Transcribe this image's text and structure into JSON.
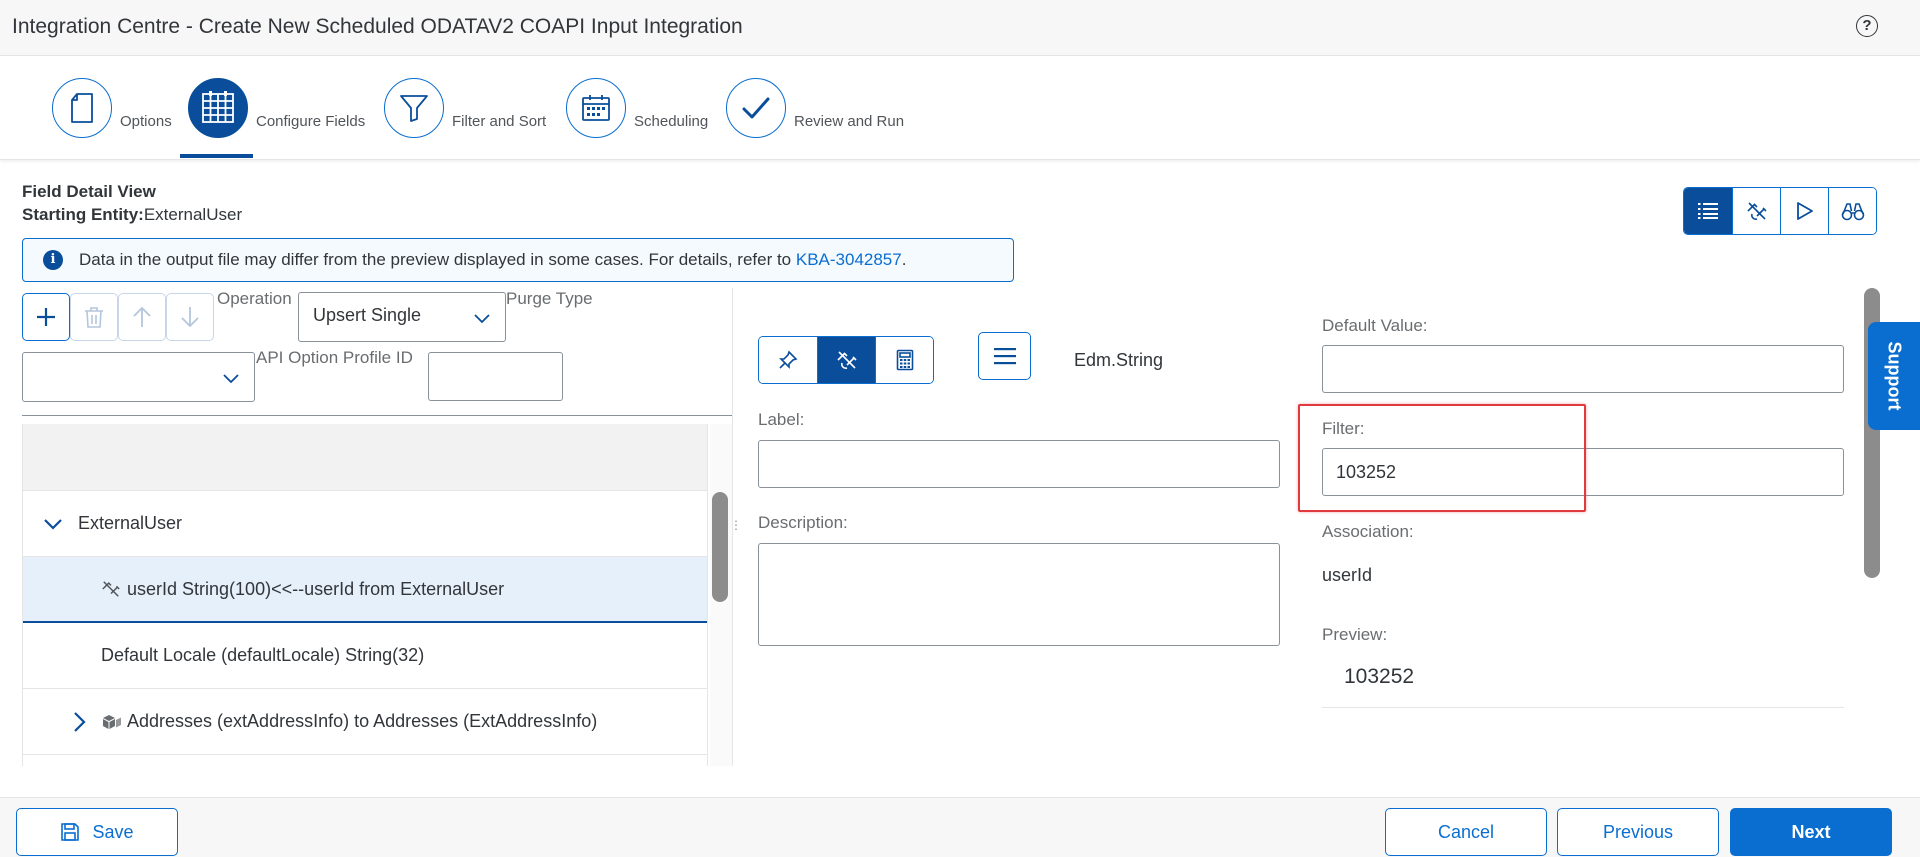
{
  "header": {
    "title": "Integration Centre - Create New Scheduled ODATAV2 COAPI Input Integration",
    "help_symbol": "?"
  },
  "wizard": {
    "steps": [
      {
        "label": "Options",
        "icon": "document-icon"
      },
      {
        "label": "Configure Fields",
        "icon": "table-icon"
      },
      {
        "label": "Filter and Sort",
        "icon": "filter-icon"
      },
      {
        "label": "Scheduling",
        "icon": "calendar-icon"
      },
      {
        "label": "Review and Run",
        "icon": "checkmark-icon"
      }
    ],
    "active_step": "Configure Fields"
  },
  "field_detail": {
    "title": "Field Detail View",
    "starting_entity_label": "Starting Entity:",
    "starting_entity_value": "ExternalUser"
  },
  "info": {
    "text": "Data in the output file may differ from the preview displayed in some cases. For details, refer to ",
    "link": "KBA-3042857",
    "suffix": "."
  },
  "left_panel": {
    "operation_label": "Operation",
    "operation_value": "Upsert Single",
    "purge_type_label": "Purge Type",
    "purge_type_value": "",
    "api_option_profile_label": "API Option Profile ID",
    "api_option_profile_value": ""
  },
  "tree": {
    "rows": [
      {
        "text": "ExternalUser",
        "icon": "chevron-down-icon"
      },
      {
        "text": "userId String(100)<<--userId from ExternalUser",
        "icon": "unlink-icon"
      },
      {
        "text": "Default Locale (defaultLocale) String(32)",
        "icon": ""
      },
      {
        "text": "Addresses (extAddressInfo) to Addresses (ExtAddressInfo)",
        "icon": "chevron-right-icon"
      }
    ]
  },
  "middle_panel": {
    "type": "Edm.String",
    "label_label": "Label:",
    "label_value": "",
    "description_label": "Description:",
    "description_value": ""
  },
  "right_panel": {
    "default_value_label": "Default Value:",
    "default_value": "",
    "filter_label": "Filter:",
    "filter_value": "103252",
    "association_label": "Association:",
    "association_value": "userId",
    "preview_label": "Preview:",
    "preview_value": "103252"
  },
  "support": {
    "label": "Support"
  },
  "footer": {
    "save": "Save",
    "cancel": "Cancel",
    "previous": "Previous",
    "next": "Next"
  },
  "colors": {
    "accent": "#0a6ed1",
    "accent_dark": "#0a4e9b",
    "highlight": "#e0393e"
  }
}
